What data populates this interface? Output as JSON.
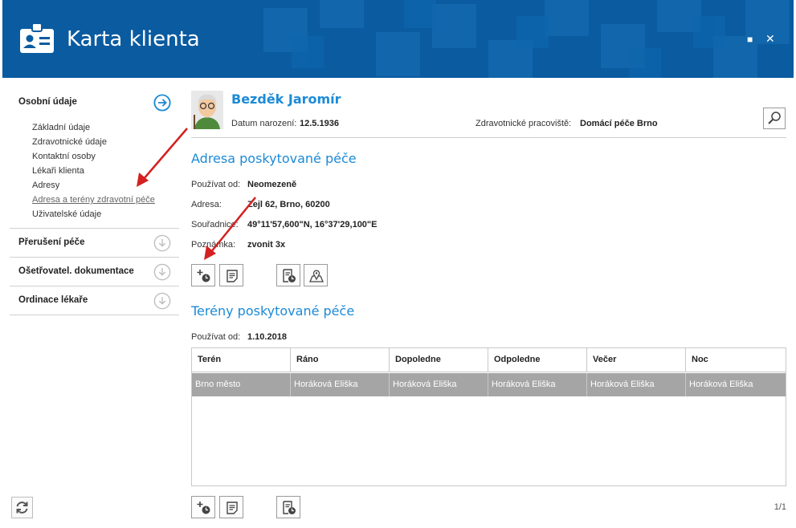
{
  "window": {
    "title": "Karta klienta",
    "maximize_glyph": "■",
    "close_glyph": "✕"
  },
  "sidebar": {
    "sections": [
      {
        "label": "Osobní údaje",
        "expanded": true
      },
      {
        "label": "Přerušení péče"
      },
      {
        "label": "Ošetřovatel. dokumentace"
      },
      {
        "label": "Ordinace lékaře"
      }
    ],
    "items": [
      {
        "label": "Základní údaje"
      },
      {
        "label": "Zdravotnické údaje"
      },
      {
        "label": "Kontaktní osoby"
      },
      {
        "label": "Lékaři klienta"
      },
      {
        "label": "Adresy"
      },
      {
        "label": "Adresa a terény zdravotní péče",
        "current": true
      },
      {
        "label": "Uživatelské údaje"
      }
    ]
  },
  "client": {
    "name": "Bezděk Jaromír",
    "dob_label": "Datum narození:",
    "dob": "12.5.1936",
    "workplace_label": "Zdravotnické pracoviště:",
    "workplace": "Domácí péče Brno"
  },
  "address_section": {
    "title": "Adresa poskytované péče",
    "rows": [
      {
        "label": "Používat od:",
        "value": "Neomezeně"
      },
      {
        "label": "Adresa:",
        "value": "Zejl 62, Brno, 60200"
      },
      {
        "label": "Souřadnice:",
        "value": "49°11'57,600\"N, 16°37'29,100\"E"
      },
      {
        "label": "Poznámka:",
        "value": "zvonit 3x"
      }
    ]
  },
  "terrain_section": {
    "title": "Terény poskytované péče",
    "use_from_label": "Používat od:",
    "use_from": "1.10.2018",
    "columns": [
      "Terén",
      "Ráno",
      "Dopoledne",
      "Odpoledne",
      "Večer",
      "Noc"
    ],
    "rows": [
      [
        "Brno město",
        "Horáková Eliška",
        "Horáková Eliška",
        "Horáková Eliška",
        "Horáková Eliška",
        "Horáková Eliška"
      ]
    ]
  },
  "pager": {
    "text": "1/1"
  },
  "colors": {
    "header_bg": "#0a5ba0",
    "accent": "#1c8ad6",
    "selected_row": "#a5a5a5",
    "annotation_arrow": "#d42020"
  }
}
